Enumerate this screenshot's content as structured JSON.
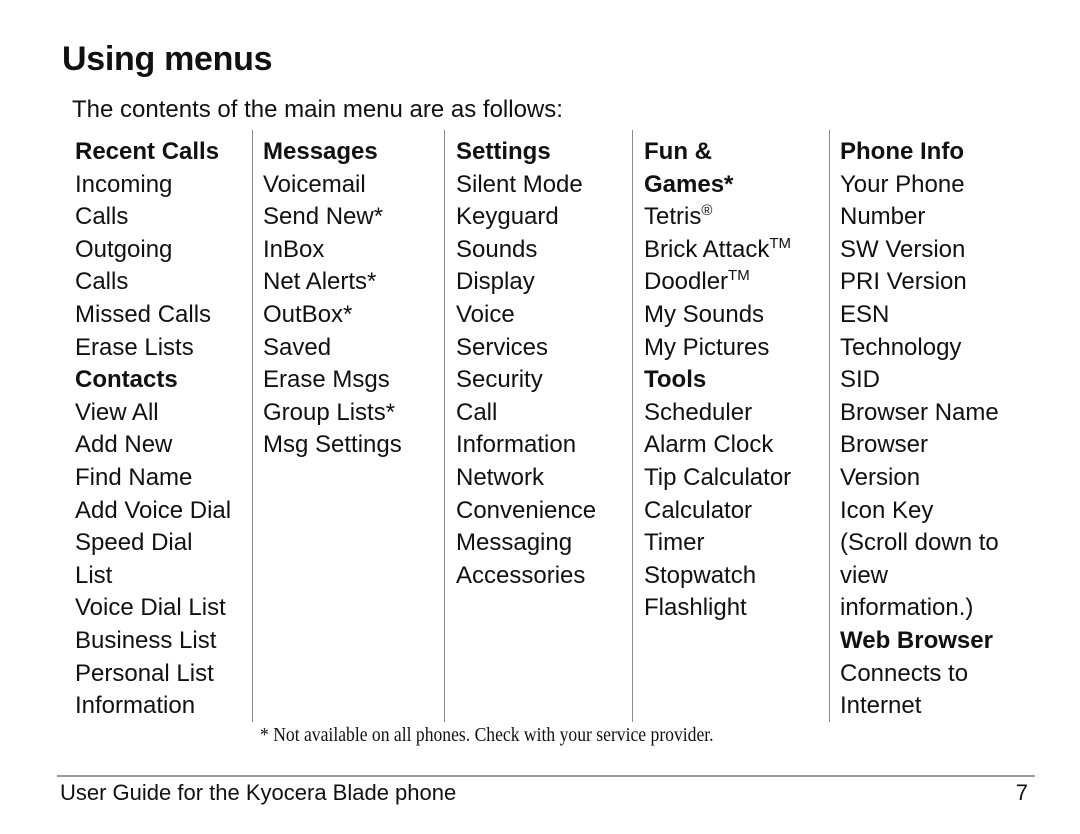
{
  "page": {
    "title": "Using menus",
    "intro": "The contents of the main menu are as follows:",
    "footnote": "* Not available on all phones. Check with your service provider.",
    "footer_text": "User Guide for the Kyocera Blade phone",
    "page_number": "7"
  },
  "columns": [
    {
      "items": [
        {
          "text": "Recent Calls",
          "heading": true
        },
        {
          "text": "Incoming"
        },
        {
          "text": "Calls"
        },
        {
          "text": "Outgoing"
        },
        {
          "text": "Calls"
        },
        {
          "text": "Missed Calls"
        },
        {
          "text": "Erase Lists"
        },
        {
          "text": "Contacts",
          "heading": true
        },
        {
          "text": "View All"
        },
        {
          "text": "Add New"
        },
        {
          "text": "Find Name"
        },
        {
          "text": "Add Voice Dial"
        },
        {
          "text": "Speed Dial"
        },
        {
          "text": "List"
        },
        {
          "text": "Voice Dial List"
        },
        {
          "text": "Business List"
        },
        {
          "text": "Personal List"
        },
        {
          "text": "Information"
        }
      ]
    },
    {
      "items": [
        {
          "text": "Messages",
          "heading": true
        },
        {
          "text": "Voicemail"
        },
        {
          "text": "Send New*"
        },
        {
          "text": "InBox"
        },
        {
          "text": "Net Alerts*"
        },
        {
          "text": "OutBox*"
        },
        {
          "text": "Saved"
        },
        {
          "text": "Erase Msgs"
        },
        {
          "text": "Group Lists*"
        },
        {
          "text": "Msg Settings"
        }
      ]
    },
    {
      "items": [
        {
          "text": "Settings",
          "heading": true
        },
        {
          "text": "Silent Mode"
        },
        {
          "text": "Keyguard"
        },
        {
          "text": "Sounds"
        },
        {
          "text": "Display"
        },
        {
          "text": "Voice"
        },
        {
          "text": "Services"
        },
        {
          "text": "Security"
        },
        {
          "text": "Call"
        },
        {
          "text": "Information"
        },
        {
          "text": "Network"
        },
        {
          "text": "Convenience"
        },
        {
          "text": "Messaging"
        },
        {
          "text": "Accessories"
        }
      ]
    },
    {
      "items": [
        {
          "text": "Fun &",
          "heading": true
        },
        {
          "text": "Games*",
          "heading": true
        },
        {
          "text": "Tetris",
          "mark": "®"
        },
        {
          "text": "Brick Attack",
          "mark": "TM"
        },
        {
          "text": "Doodler",
          "mark": "TM"
        },
        {
          "text": "My Sounds"
        },
        {
          "text": "My Pictures"
        },
        {
          "text": "Tools",
          "heading": true
        },
        {
          "text": "Scheduler"
        },
        {
          "text": "Alarm Clock"
        },
        {
          "text": "Tip Calculator"
        },
        {
          "text": "Calculator"
        },
        {
          "text": "Timer"
        },
        {
          "text": "Stopwatch"
        },
        {
          "text": "Flashlight"
        }
      ]
    },
    {
      "items": [
        {
          "text": "Phone Info",
          "heading": true
        },
        {
          "text": "Your Phone"
        },
        {
          "text": "Number"
        },
        {
          "text": "SW Version"
        },
        {
          "text": "PRI Version"
        },
        {
          "text": "ESN"
        },
        {
          "text": "Technology"
        },
        {
          "text": "SID"
        },
        {
          "text": "Browser Name"
        },
        {
          "text": "Browser"
        },
        {
          "text": "Version"
        },
        {
          "text": "Icon Key"
        },
        {
          "text": "(Scroll down to"
        },
        {
          "text": "view"
        },
        {
          "text": "information.)"
        },
        {
          "text": "Web Browser",
          "heading": true
        },
        {
          "text": "Connects to"
        },
        {
          "text": "Internet"
        }
      ]
    }
  ]
}
